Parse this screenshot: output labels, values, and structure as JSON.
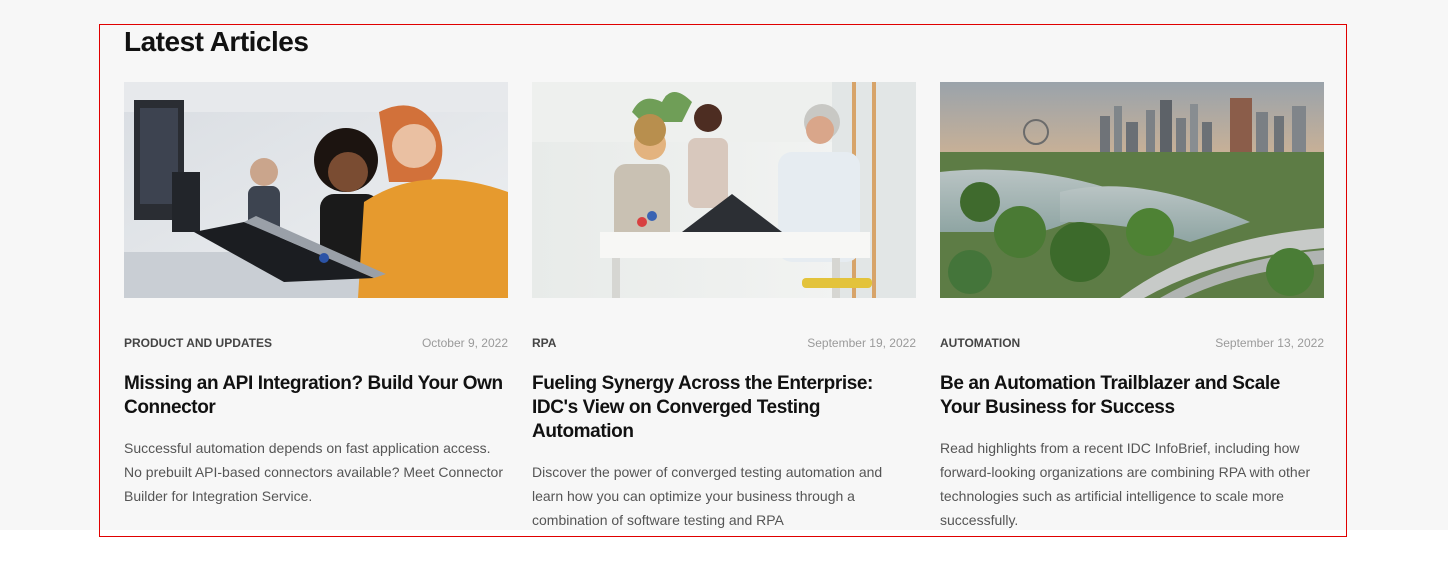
{
  "section": {
    "title": "Latest Articles"
  },
  "articles": [
    {
      "category": "PRODUCT AND UPDATES",
      "date": "October 9, 2022",
      "title": "Missing an API Integration? Build Your Own Connector",
      "excerpt": "Successful automation depends on fast application access. No prebuilt API-based connectors available? Meet Connector Builder for Integration Service.",
      "image": "office-colleagues-laptop-photo"
    },
    {
      "category": "RPA",
      "date": "September 19, 2022",
      "title": "Fueling Synergy Across the Enterprise: IDC's View on Converged Testing Automation",
      "excerpt": "Discover the power of converged testing automation and learn how you can optimize your business through a combination of software testing and RPA",
      "image": "meeting-room-discussion-photo"
    },
    {
      "category": "AUTOMATION",
      "date": "September 13, 2022",
      "title": "Be an Automation Trailblazer and Scale Your Business for Success",
      "excerpt": "Read highlights from a recent IDC InfoBrief, including how forward-looking organizations are combining RPA with other technologies such as artificial intelligence to scale more successfully.",
      "image": "city-skyline-photo"
    }
  ],
  "colors": {
    "frame": "#e00000",
    "background": "#f7f7f7",
    "text": "#111111"
  }
}
